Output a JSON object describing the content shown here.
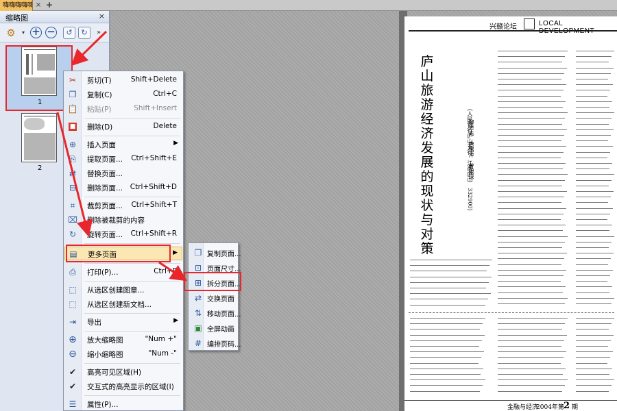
{
  "tabs": {
    "doc_tab_label": "嗨嗨嗨嗨嗨",
    "close_glyph": "×",
    "add_glyph": "+"
  },
  "thumbnails_panel": {
    "title": "缩略图",
    "close_glyph": "×",
    "pages": [
      {
        "label": "1",
        "selected": true
      },
      {
        "label": "2",
        "selected": false
      }
    ]
  },
  "context_menu": {
    "items": [
      {
        "label": "剪切(T)",
        "shortcut": "Shift+Delete",
        "icon": "scissors-icon",
        "disabled": false
      },
      {
        "label": "复制(C)",
        "shortcut": "Ctrl+C",
        "icon": "copy-icon",
        "disabled": false
      },
      {
        "label": "粘贴(P)",
        "shortcut": "Shift+Insert",
        "icon": "paste-icon",
        "disabled": true
      },
      {
        "label": "删除(D)",
        "shortcut": "Delete",
        "icon": "delete-icon",
        "disabled": false
      },
      {
        "label": "插入页面",
        "shortcut": "",
        "icon": "insert-page-icon",
        "disabled": false,
        "submenu": true
      },
      {
        "label": "提取页面...",
        "shortcut": "Ctrl+Shift+E",
        "icon": "extract-page-icon",
        "disabled": false
      },
      {
        "label": "替换页面...",
        "shortcut": "",
        "icon": "replace-page-icon",
        "disabled": false
      },
      {
        "label": "删除页面...",
        "shortcut": "Ctrl+Shift+D",
        "icon": "delete-page-icon",
        "disabled": false
      },
      {
        "label": "裁剪页面...",
        "shortcut": "Ctrl+Shift+T",
        "icon": "crop-page-icon",
        "disabled": false
      },
      {
        "label": "删除被裁剪的内容",
        "shortcut": "",
        "icon": "remove-cropped-icon",
        "disabled": false
      },
      {
        "label": "旋转页面...",
        "shortcut": "Ctrl+Shift+R",
        "icon": "rotate-page-icon",
        "disabled": false
      },
      {
        "label": "更多页面",
        "shortcut": "",
        "icon": "more-pages-icon",
        "disabled": false,
        "submenu": true,
        "highlighted": true
      },
      {
        "label": "打印(P)...",
        "shortcut": "Ctrl+P",
        "icon": "print-icon",
        "disabled": false
      },
      {
        "label": "从选区创建图章...",
        "shortcut": "",
        "icon": "stamp-icon",
        "disabled": false
      },
      {
        "label": "从选区创建新文档...",
        "shortcut": "",
        "icon": "new-doc-icon",
        "disabled": false
      },
      {
        "label": "导出",
        "shortcut": "",
        "icon": "export-icon",
        "disabled": false,
        "submenu": true
      },
      {
        "label": "放大缩略图",
        "shortcut": "\"Num +\"",
        "icon": "zoom-in-icon",
        "disabled": false
      },
      {
        "label": "缩小缩略图",
        "shortcut": "\"Num -\"",
        "icon": "zoom-out-icon",
        "disabled": false
      },
      {
        "label": "高亮可见区域(H)",
        "shortcut": "",
        "icon": "check-icon",
        "disabled": false
      },
      {
        "label": "交互式的高亮显示的区域(I)",
        "shortcut": "",
        "icon": "check-icon",
        "disabled": false
      },
      {
        "label": "属性(P)...",
        "shortcut": "",
        "icon": "properties-icon",
        "disabled": false
      }
    ]
  },
  "submenu": {
    "items": [
      {
        "label": "复制页面...",
        "icon": "duplicate-page-icon"
      },
      {
        "label": "页面尺寸...",
        "icon": "page-size-icon"
      },
      {
        "label": "拆分页面...",
        "icon": "split-page-icon",
        "highlighted": true
      },
      {
        "label": "交换页面",
        "icon": "swap-page-icon"
      },
      {
        "label": "移动页面...",
        "icon": "move-page-icon"
      },
      {
        "label": "全屏动画",
        "icon": "fullscreen-animation-icon"
      },
      {
        "label": "编排页码...",
        "icon": "page-numbering-icon"
      }
    ]
  },
  "document_page": {
    "header_cn": "兴赣论坛",
    "header_en": "LOCAL  DEVELOPMENT",
    "title": "庐山旅游经济发展的现状与对策",
    "authors": "柳述先　唐馆萍　曾银球",
    "org": "（人民银行庐山支行　江西庐山　332900）",
    "footer_journal": "金融与经济",
    "footer_year": "2004年第",
    "footer_num": "2",
    "footer_period": "期"
  },
  "colors": {
    "highlight_red": "#e8262c",
    "menu_highlight": "#fbe7b3",
    "panel_bg": "#dfe6f2"
  }
}
